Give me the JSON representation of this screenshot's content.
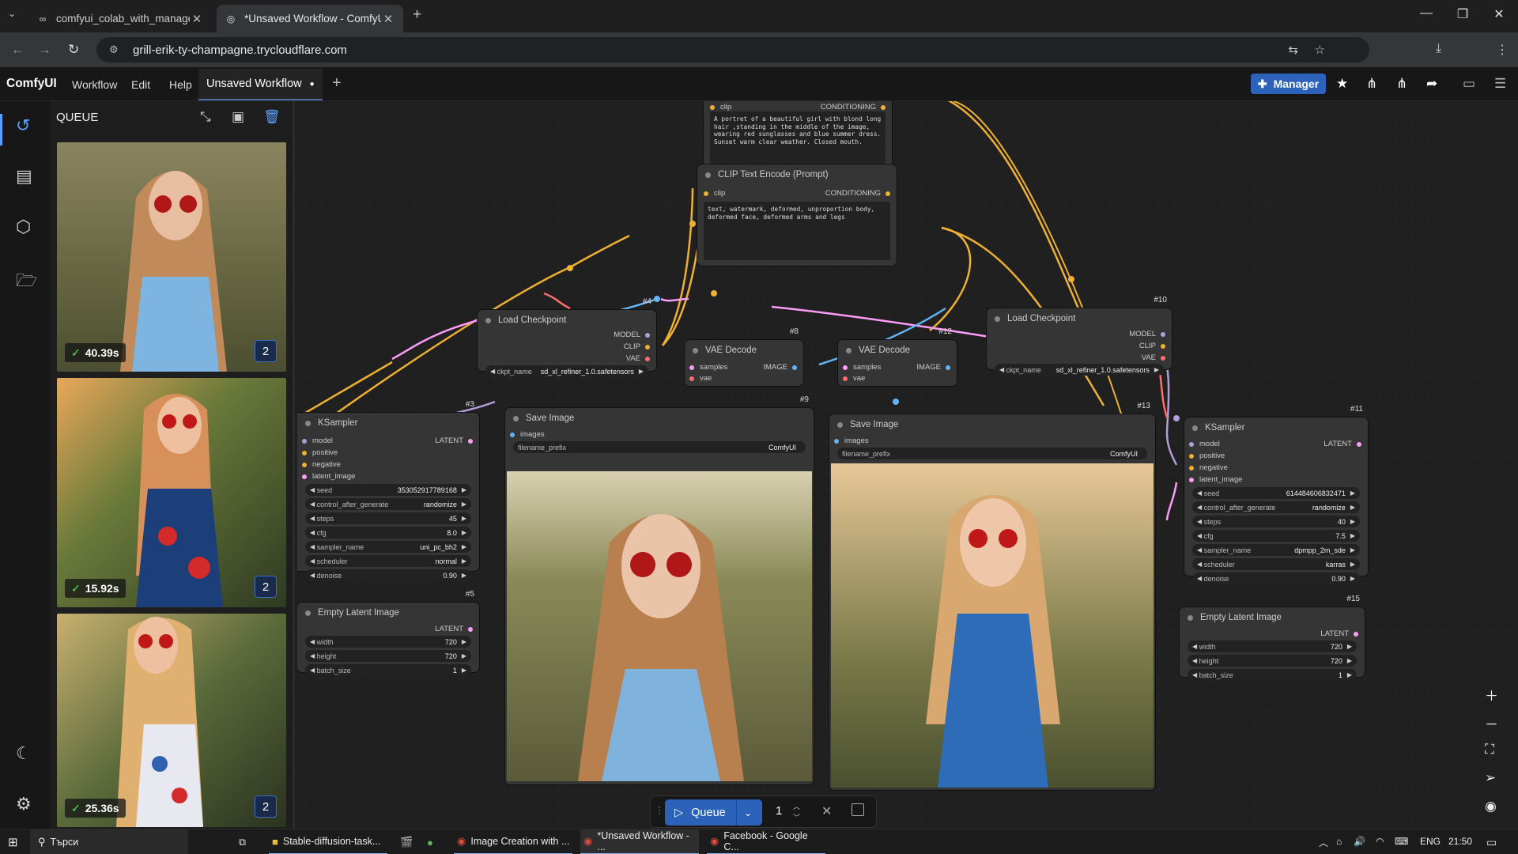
{
  "browser": {
    "tabs": [
      {
        "title": "comfyui_colab_with_manager.ip",
        "icon": "colab-icon"
      },
      {
        "title": "*Unsaved Workflow - ComfyUI",
        "icon": "globe-icon"
      }
    ],
    "url": "grill-erik-ty-champagne.trycloudflare.com"
  },
  "menubar": {
    "brand": "ComfyUI",
    "items": [
      "Workflow",
      "Edit",
      "Help"
    ],
    "workflow_tab": "Unsaved Workflow",
    "manager_label": "Manager"
  },
  "queue_panel": {
    "title": "QUEUE",
    "items": [
      {
        "time": "40.39s",
        "count": "2"
      },
      {
        "time": "15.92s",
        "count": "2"
      },
      {
        "time": "25.36s",
        "count": "2"
      }
    ]
  },
  "nodes": {
    "clip_top": {
      "clip": "clip",
      "conditioning": "CONDITIONING",
      "text": "A portret of a beautiful girl with blond long hair ,standing in the middle of the image, wearing red sunglasses and blue summer dress. Sunset warm clear weather. Closed mouth.",
      "id": "#7"
    },
    "clip_neg": {
      "title": "CLIP Text Encode (Prompt)",
      "clip": "clip",
      "conditioning": "CONDITIONING",
      "text": "text, watermark, deformed, unproportion body, deformed face, deformed arms and legs",
      "id": "#8"
    },
    "load_ckpt_1": {
      "title": "Load Checkpoint",
      "id": "#4",
      "outputs": [
        "MODEL",
        "CLIP",
        "VAE"
      ],
      "ckpt_label": "ckpt_name",
      "ckpt_value": "sd_xl_refiner_1.0.safetensors"
    },
    "load_ckpt_2": {
      "title": "Load Checkpoint",
      "id": "#10",
      "outputs": [
        "MODEL",
        "CLIP",
        "VAE"
      ],
      "ckpt_label": "ckpt_name",
      "ckpt_value": "sd_xl_refiner_1.0.safetensors"
    },
    "vae_decode_1": {
      "title": "VAE Decode",
      "id": "#9",
      "inputs": [
        "samples",
        "vae"
      ],
      "output": "IMAGE"
    },
    "vae_decode_2": {
      "title": "VAE Decode",
      "id": "#12",
      "inputs": [
        "samples",
        "vae"
      ],
      "output": "IMAGE"
    },
    "ksampler_1": {
      "title": "KSampler",
      "id": "#3",
      "inputs": [
        "model",
        "positive",
        "negative",
        "latent_image"
      ],
      "output": "LATENT",
      "widgets": [
        {
          "name": "seed",
          "value": "353052917789168"
        },
        {
          "name": "control_after_generate",
          "value": "randomize"
        },
        {
          "name": "steps",
          "value": "45"
        },
        {
          "name": "cfg",
          "value": "8.0"
        },
        {
          "name": "sampler_name",
          "value": "uni_pc_bh2"
        },
        {
          "name": "scheduler",
          "value": "normal"
        },
        {
          "name": "denoise",
          "value": "0.90"
        }
      ]
    },
    "ksampler_2": {
      "title": "KSampler",
      "id": "#11",
      "inputs": [
        "model",
        "positive",
        "negative",
        "latent_image"
      ],
      "output": "LATENT",
      "widgets": [
        {
          "name": "seed",
          "value": "614484606832471"
        },
        {
          "name": "control_after_generate",
          "value": "randomize"
        },
        {
          "name": "steps",
          "value": "40"
        },
        {
          "name": "cfg",
          "value": "7.5"
        },
        {
          "name": "sampler_name",
          "value": "dpmpp_2m_sde"
        },
        {
          "name": "scheduler",
          "value": "karras"
        },
        {
          "name": "denoise",
          "value": "0.90"
        }
      ]
    },
    "save_image_1": {
      "title": "Save Image",
      "id": "#9",
      "input": "images",
      "prefix_label": "filename_prefix",
      "prefix_value": "ComfyUI"
    },
    "save_image_2": {
      "title": "Save Image",
      "id": "#13",
      "input": "images",
      "prefix_label": "filename_prefix",
      "prefix_value": "ComfyUI"
    },
    "empty_latent_1": {
      "title": "Empty Latent Image",
      "id": "#5",
      "output": "LATENT",
      "widgets": [
        {
          "name": "width",
          "value": "720"
        },
        {
          "name": "height",
          "value": "720"
        },
        {
          "name": "batch_size",
          "value": "1"
        }
      ]
    },
    "empty_latent_2": {
      "title": "Empty Latent Image",
      "id": "#15",
      "output": "LATENT",
      "widgets": [
        {
          "name": "width",
          "value": "720"
        },
        {
          "name": "height",
          "value": "720"
        },
        {
          "name": "batch_size",
          "value": "1"
        }
      ]
    }
  },
  "queue_bar": {
    "label": "Queue",
    "count": "1"
  },
  "taskbar": {
    "search": "Търси",
    "apps": [
      "Stable-diffusion-task...",
      "Image Creation with ...",
      "*Unsaved Workflow - ...",
      "Facebook - Google C..."
    ],
    "lang": "ENG",
    "time": "21:50"
  },
  "colors": {
    "accent": "#2c62ba",
    "wire_model": "#b39ddb",
    "wire_clip": "#f0b030",
    "wire_vae": "#ff6e6e",
    "wire_latent": "#ff9cf9",
    "wire_image": "#64b5f6"
  }
}
